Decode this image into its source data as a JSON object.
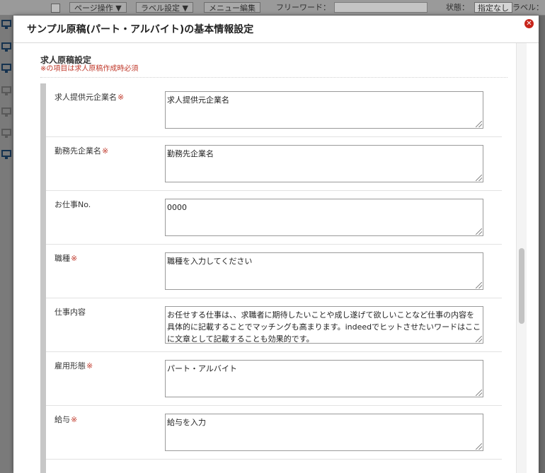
{
  "background_toolbar": {
    "page_ops_label": "ページ操作 ▼",
    "label_settings_label": "ラベル設定 ▼",
    "menu_edit_label": "メニュー編集",
    "free_word_label": "フリーワード：",
    "status_label": "状態：",
    "status_value": "指定なし",
    "label_filter_label": "ラベル："
  },
  "modal": {
    "title": "サンプル原稿(パート・アルバイト)の基本情報設定",
    "close_icon": "close-icon"
  },
  "section": {
    "title": "求人原稿設定",
    "required_note": "※の項目は求人原稿作成時必須"
  },
  "fields": [
    {
      "label": "求人提供元企業名",
      "required": "※",
      "value": "求人提供元企業名"
    },
    {
      "label": "勤務先企業名",
      "required": "※",
      "value": "勤務先企業名"
    },
    {
      "label": "お仕事No.",
      "required": "",
      "value": "0000"
    },
    {
      "label": "職種",
      "required": "※",
      "value": "職種を入力してください"
    },
    {
      "label": "仕事内容",
      "required": "",
      "value": "お任せする仕事は、、求職者に期待したいことや成し遂げて欲しいことなど仕事の内容を具体的に記載することでマッチングも高まります。indeedでヒットさせたいワードはここに文章として記載することも効果的です。"
    },
    {
      "label": "雇用形態",
      "required": "※",
      "value": "パート・アルバイト"
    },
    {
      "label": "給与",
      "required": "※",
      "value": "給与を入力"
    }
  ],
  "colors": {
    "required_red": "#c0392b",
    "close_button": "#c8251b",
    "left_bar": "#c7c7c7"
  }
}
